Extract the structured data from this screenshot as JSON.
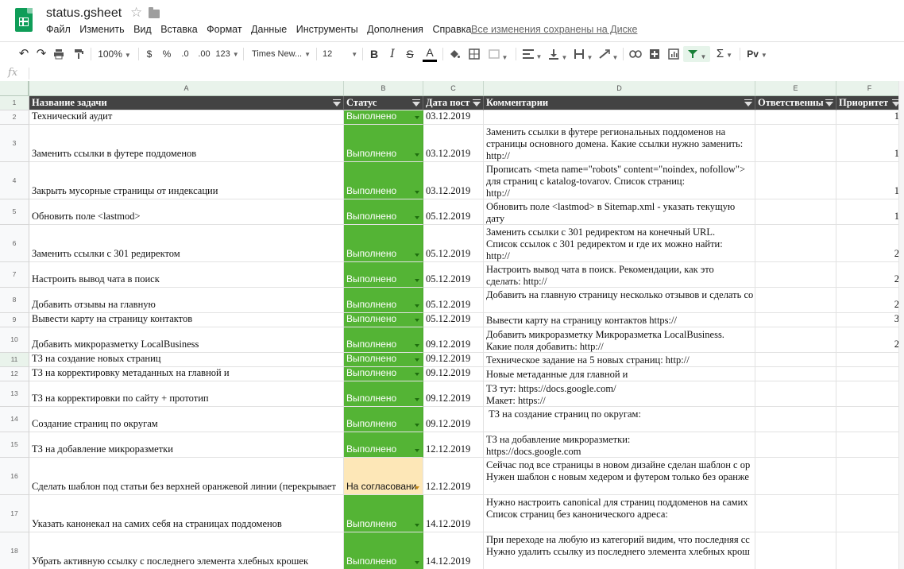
{
  "app": {
    "doc_title": "status.gsheet",
    "menu": [
      "Файл",
      "Изменить",
      "Вид",
      "Вставка",
      "Формат",
      "Данные",
      "Инструменты",
      "Дополнения",
      "Справка"
    ],
    "save_status": "Все изменения сохранены на Диске",
    "fx_label": "fx"
  },
  "toolbar": {
    "zoom": "100%",
    "currency": "$",
    "percent": "%",
    "dec_decrease": ".0",
    "dec_increase": ".00",
    "more_formats": "123",
    "font": "Times New...",
    "font_size": "12",
    "bold": "B",
    "italic": "I",
    "strike": "S",
    "text_color": "A",
    "sum": "Σ",
    "input_tools": "Рv"
  },
  "grid": {
    "columns": [
      "A",
      "B",
      "C",
      "D",
      "E",
      "F"
    ],
    "headers": [
      "Название задачи",
      "Статус",
      "Дата пост",
      "Комментарии",
      "Ответственны",
      "Приоритет"
    ],
    "rows": [
      {
        "n": "2",
        "task": "Технический аудит",
        "status": "Выполнено",
        "date": "03.12.2019",
        "comment": "",
        "owner": "",
        "priority": "1"
      },
      {
        "n": "3",
        "task": "Заменить ссылки в футере поддоменов",
        "status": "Выполнено",
        "date": "03.12.2019",
        "comment": "Заменить ссылки в футере региональных поддоменов на\nстраницы основного домена. Какие ссылки нужно заменить:\nhttp://",
        "owner": "",
        "priority": "1"
      },
      {
        "n": "4",
        "task": "Закрыть мусорные страницы от индексации",
        "status": "Выполнено",
        "date": "03.12.2019",
        "comment": "Прописать <meta name=\"robots\" content=\"noindex, nofollow\">\nдля страниц с katalog-tovarov. Список страниц:\nhttp://",
        "owner": "",
        "priority": "1"
      },
      {
        "n": "5",
        "task": "Обновить поле <lastmod>",
        "status": "Выполнено",
        "date": "05.12.2019",
        "comment": "Обновить поле <lastmod> в Sitemap.xml - указать текущую\nдату",
        "owner": "",
        "priority": "1"
      },
      {
        "n": "6",
        "task": "Заменить ссылки с 301 редиректом",
        "status": "Выполнено",
        "date": "05.12.2019",
        "comment": "Заменить ссылки с 301 редиректом на конечный URL.\nСписок ссылок с 301 редиректом и где их можно найти:\nhttp://",
        "owner": "",
        "priority": "2"
      },
      {
        "n": "7",
        "task": "Настроить вывод чата в поиск",
        "status": "Выполнено",
        "date": "05.12.2019",
        "comment": "Настроить вывод чата в поиск. Рекомендации, как это\nсделать: http://",
        "owner": "",
        "priority": "2"
      },
      {
        "n": "8",
        "task": "Добавить отзывы на главную",
        "status": "Выполнено",
        "date": "05.12.2019",
        "comment": "Добавить на главную страницу несколько отзывов и сделать со",
        "owner": "",
        "priority": "2"
      },
      {
        "n": "9",
        "task": "Вывести карту на страницу контактов",
        "status": "Выполнено",
        "date": "05.12.2019",
        "comment": "Вывести карту на страницу контактов https://",
        "owner": "",
        "priority": "3"
      },
      {
        "n": "10",
        "task": "Добавить микроразметку LocalBusiness",
        "status": "Выполнено",
        "date": "09.12.2019",
        "comment": "Добавить микроразметку Микроразметка LocalBusiness.\nКакие поля добавить: http://",
        "owner": "",
        "priority": "2"
      },
      {
        "n": "11",
        "task": "ТЗ на создание новых страниц",
        "status": "Выполнено",
        "date": "09.12.2019",
        "comment": "Техническое задание на 5 новых страниц: http://",
        "owner": "",
        "priority": ""
      },
      {
        "n": "12",
        "task": "ТЗ на корректировку метаданных на главной и",
        "status": "Выполнено",
        "date": "09.12.2019",
        "comment": "Новые метаданные для главной и",
        "owner": "",
        "priority": ""
      },
      {
        "n": "13",
        "task": "ТЗ на корректировки по сайту + прототип",
        "status": "Выполнено",
        "date": "09.12.2019",
        "comment": "ТЗ тут: https://docs.google.com/\nМакет: https://",
        "owner": "",
        "priority": ""
      },
      {
        "n": "14",
        "task": "Создание страниц по округам",
        "status": "Выполнено",
        "date": "09.12.2019",
        "comment": " ТЗ на создание страниц по округам:",
        "owner": "",
        "priority": ""
      },
      {
        "n": "15",
        "task": "ТЗ на добавление микроразметки",
        "status": "Выполнено",
        "date": "12.12.2019",
        "comment": "ТЗ на добавление микроразметки:\nhttps://docs.google.com",
        "owner": "",
        "priority": ""
      },
      {
        "n": "16",
        "task": "Сделать шаблон под статьи без верхней оранжевой линии (перекрывает",
        "status": "На согласовани",
        "date": "12.12.2019",
        "comment": "Сейчас под все страницы в новом дизайне сделан шаблон с ор\nНужен шаблон с новым хедером и футером только без оранже",
        "owner": "",
        "priority": ""
      },
      {
        "n": "17",
        "task": "Указать канонекал на самих себя на страницах поддоменов",
        "status": "Выполнено",
        "date": "14.12.2019",
        "comment": "Нужно настроить canonical для страниц поддоменов на самих\nСписок страниц без канонического адреса:",
        "owner": "",
        "priority": ""
      },
      {
        "n": "18",
        "task": "Убрать активную ссылку с последнего элемента хлебных крошек",
        "status": "Выполнено",
        "date": "14.12.2019",
        "comment": "При переходе на любую из категорий видим, что последняя сс\nНужно удалить ссылку из последнего элемента хлебных крош",
        "owner": "",
        "priority": ""
      }
    ]
  },
  "colors": {
    "status_done": "#54b435",
    "status_pending": "#fde7b7",
    "header_bg": "#434343",
    "col_header_bg": "#e9f3eb"
  }
}
